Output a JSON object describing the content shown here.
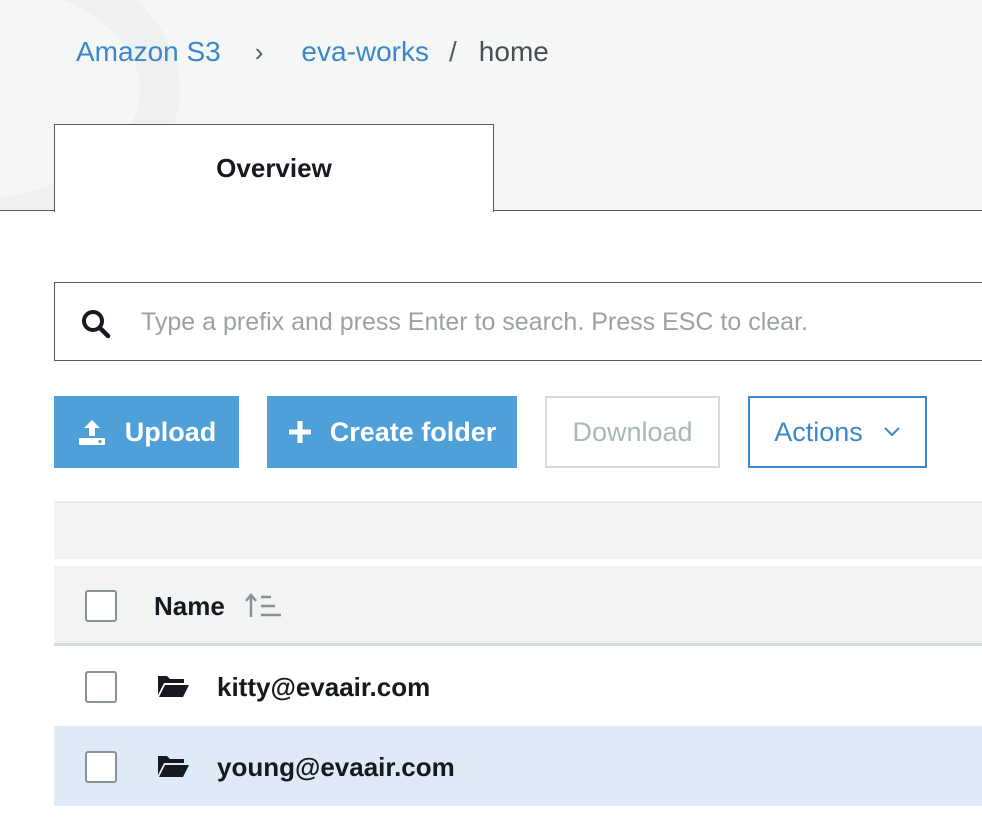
{
  "breadcrumb": {
    "root": "Amazon S3",
    "separator_1": "›",
    "bucket": "eva-works",
    "separator_2": "/",
    "current": "home"
  },
  "tabs": [
    {
      "label": "Overview",
      "active": true
    }
  ],
  "search": {
    "value": "",
    "placeholder": "Type a prefix and press Enter to search. Press ESC to clear."
  },
  "toolbar": {
    "upload_label": "Upload",
    "create_folder_label": "Create folder",
    "download_label": "Download",
    "actions_label": "Actions"
  },
  "table": {
    "columns": [
      {
        "label": "Name",
        "sort": "ascending"
      }
    ],
    "rows": [
      {
        "name": "kitty@evaair.com",
        "type": "folder",
        "checked": false
      },
      {
        "name": "young@evaair.com",
        "type": "folder",
        "checked": false,
        "highlighted": true
      }
    ]
  },
  "colors": {
    "link": "#3a88c9",
    "primary_button": "#4f9fd8",
    "row_highlight": "#deeaf5",
    "disabled_text": "#aab7b8"
  },
  "icons": {
    "search": "search-icon",
    "upload": "upload-icon",
    "create": "plus-icon",
    "actions": "chevron-down-icon",
    "sort": "sort-ascending-icon",
    "folder": "folder-open-icon"
  }
}
